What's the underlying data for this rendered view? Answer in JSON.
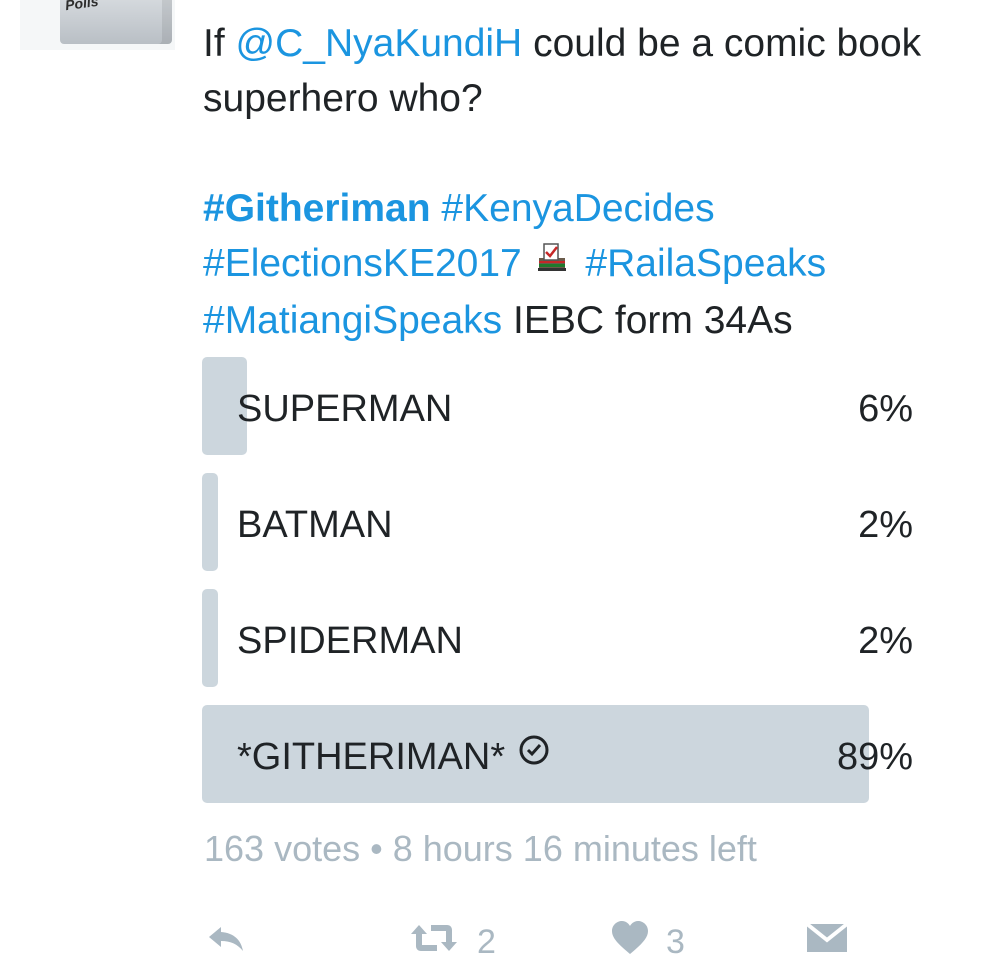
{
  "avatar": {
    "text": "Polls"
  },
  "tweet": {
    "prefix": "If ",
    "mention": "@C_NyaKundiH",
    "suffix": " could be a comic book superhero who?",
    "hashtags": {
      "githeriman": "#Githeriman",
      "kenya_decides": "#KenyaDecides",
      "elections": "#ElectionsKE2017",
      "raila": "#RailaSpeaks",
      "matiangi": "#MatiangiSpeaks"
    },
    "trailing_text": " IEBC form 34As"
  },
  "poll": {
    "options": [
      {
        "label": "SUPERMAN",
        "percent_text": "6%",
        "percent": 6,
        "selected": false
      },
      {
        "label": "BATMAN",
        "percent_text": "2%",
        "percent": 2,
        "selected": false
      },
      {
        "label": "SPIDERMAN",
        "percent_text": "2%",
        "percent": 2,
        "selected": false
      },
      {
        "label": "*GITHERIMAN*",
        "percent_text": "89%",
        "percent": 89,
        "selected": true
      }
    ],
    "footer": "163 votes • 8 hours 16 minutes left"
  },
  "actions": {
    "reply": "reply-icon",
    "retweet": "retweet-icon",
    "retweet_count": "2",
    "like": "heart-icon",
    "like_count": "3",
    "message": "direct-message-icon"
  },
  "colors": {
    "link": "#1b95e0",
    "poll_bar": "#ccd6dd",
    "muted": "#aab8c2",
    "text": "#1f2326"
  }
}
